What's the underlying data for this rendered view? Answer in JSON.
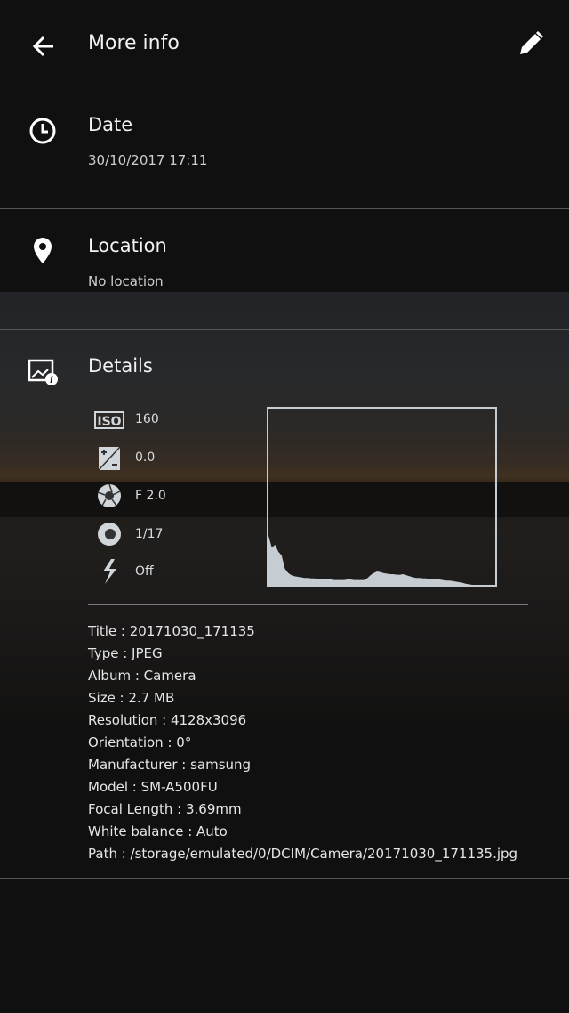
{
  "header": {
    "title": "More info",
    "back_icon": "arrow-left-icon",
    "edit_icon": "pencil-icon"
  },
  "date": {
    "title": "Date",
    "value": "30/10/2017 17:11",
    "icon": "clock-icon"
  },
  "location": {
    "title": "Location",
    "value": "No location",
    "icon": "map-pin-icon"
  },
  "details": {
    "title": "Details",
    "icon": "image-info-icon",
    "exif": [
      {
        "icon": "iso-icon",
        "value": "160"
      },
      {
        "icon": "exposure-icon",
        "value": "0.0"
      },
      {
        "icon": "aperture-icon",
        "value": "F 2.0"
      },
      {
        "icon": "shutter-icon",
        "value": "1/17"
      },
      {
        "icon": "flash-icon",
        "value": "Off"
      }
    ],
    "histogram": [
      92,
      70,
      75,
      62,
      55,
      30,
      22,
      18,
      16,
      15,
      14,
      13,
      13,
      12,
      12,
      11,
      11,
      10,
      10,
      10,
      9,
      9,
      9,
      9,
      10,
      10,
      9,
      9,
      9,
      9,
      12,
      18,
      22,
      25,
      24,
      22,
      21,
      20,
      20,
      19,
      19,
      20,
      18,
      16,
      14,
      13,
      13,
      12,
      12,
      11,
      11,
      10,
      10,
      9,
      8,
      8,
      7,
      6,
      5,
      4,
      2,
      1,
      0,
      0,
      0,
      0,
      0,
      0,
      0,
      0
    ],
    "properties": [
      "Title : 20171030_171135",
      "Type : JPEG",
      "Album : Camera",
      "Size : 2.7 MB",
      "Resolution : 4128x3096",
      "Orientation : 0°",
      "Manufacturer : samsung",
      "Model : SM-A500FU",
      "Focal Length : 3.69mm",
      "White balance : Auto",
      "Path : /storage/emulated/0/DCIM/Camera/20171030_171135.jpg"
    ]
  },
  "colors": {
    "background": "#101010",
    "histogram": "#c5ccd2"
  }
}
